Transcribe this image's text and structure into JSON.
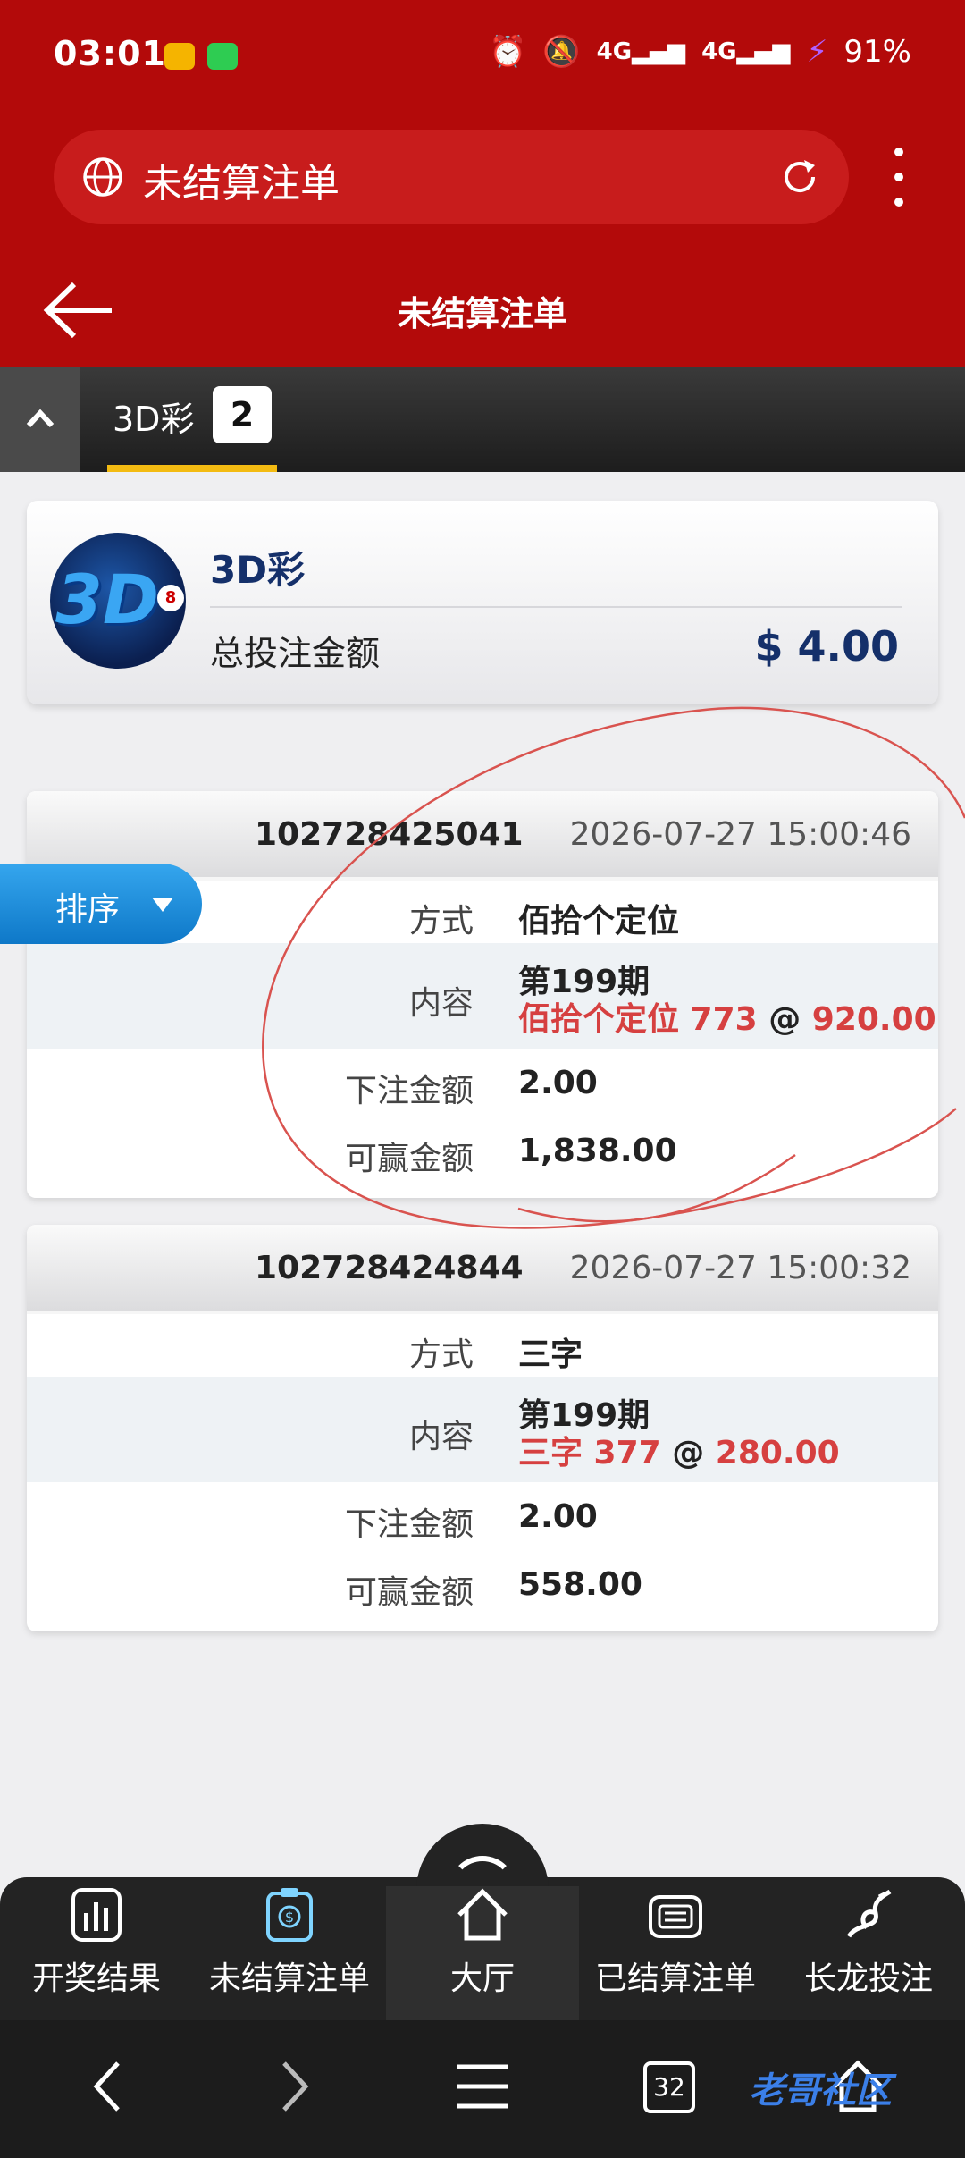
{
  "status_bar": {
    "time": "03:01",
    "battery": "91%",
    "net1": "4G",
    "net2": "4G"
  },
  "browser": {
    "url_title": "未结算注单"
  },
  "header": {
    "title": "未结算注单"
  },
  "tabs": [
    {
      "label": "3D彩",
      "count": "2"
    }
  ],
  "summary": {
    "game": "3D彩",
    "total_label": "总投注金额",
    "total_amount": "$ 4.00",
    "logo_text": "3D",
    "logo_ball": "8"
  },
  "sort_button": {
    "label": "排序"
  },
  "bets": [
    {
      "id": "102728425041",
      "time": "2026-07-27 15:00:46",
      "method_label": "方式",
      "method": "佰拾个定位",
      "content_label": "内容",
      "period": "第199期",
      "content_type": "佰拾个定位 773",
      "at": "@",
      "odds": "920.00",
      "stake_label": "下注金额",
      "stake": "2.00",
      "win_label": "可赢金额",
      "win": "1,838.00"
    },
    {
      "id": "102728424844",
      "time": "2026-07-27 15:00:32",
      "method_label": "方式",
      "method": "三字",
      "content_label": "内容",
      "period": "第199期",
      "content_type": "三字 377",
      "at": "@",
      "odds": "280.00",
      "stake_label": "下注金额",
      "stake": "2.00",
      "win_label": "可赢金额",
      "win": "558.00"
    }
  ],
  "bottom_nav": [
    {
      "label": "开奖结果",
      "icon": "bar-chart-icon"
    },
    {
      "label": "未结算注单",
      "icon": "clipboard-dollar-icon"
    },
    {
      "label": "大厅",
      "icon": "home-icon"
    },
    {
      "label": "已结算注单",
      "icon": "ticket-icon"
    },
    {
      "label": "长龙投注",
      "icon": "dragon-icon"
    }
  ],
  "system_nav": {
    "tab_count": "32"
  },
  "watermark": {
    "text": "老哥社区"
  },
  "colors": {
    "brand_red": "#b30a0a",
    "accent_yellow": "#f3bb12",
    "odds_red": "#d64040",
    "navy": "#15306a",
    "sort_blue": "#1a8ad8"
  }
}
